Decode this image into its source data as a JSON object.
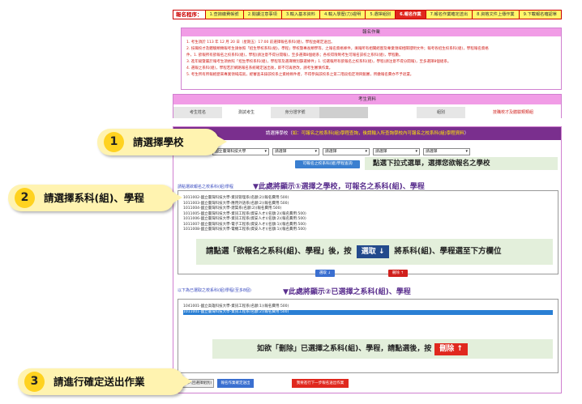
{
  "steps": {
    "lead": "報名程序：",
    "items": [
      "1.查詢繳費帳號",
      "2.閱讀注意事項",
      "3.輸入基本資料",
      "4.輸入學歷(力)證明",
      "5.選擇組別",
      "6.報名作業",
      "7.報名作業確定送出",
      "8.資格文件上傳作業",
      "9.下載報名確認單"
    ],
    "active_index": 5
  },
  "notice": {
    "title": "報名作業",
    "items": [
      "1. 考生須於 113 年 12 月 20 日（星期五）17:00 前選擇報名系科(組)，學程並確定送出。",
      "2. 技職校才及體驗類類報考生請依照「招生學校系科(組)，學程」學校暨專長類學等，之報名資格條件，填報所有相關經歷及專業領域相關證明文件；報考各招生校系科(組)，學程報名資格",
      "   件，1. 欲報所有欲報名之校系科(組)，學程(請注意不得分開報)，至多選擇8個組系；各校得限制考生可報名該校之系科(組)，學程數。",
      "3. 進年級暨屬於報考生須依照「招生學校系科(組)，學程等及選擇類別篩選條件」1. 切選報所有欲報名之校系科(組)，學程(請注意不得分開報)，至多選擇8個組系。",
      "4. 選報之系科(組)，學程若於網路報名系統確定送出後，即不可再更改，請考生審慎作業。",
      "5. 考生所有所報經歷來專業領域成就，經審查未錄該校系之資格條件者，不得參與該校系之第二階段指定項目甄審，所繳報名費亦不予退還。"
    ]
  },
  "applicant": {
    "title": "考生資料",
    "name_label": "考生姓名",
    "name_value": "測試考生",
    "id_label": "身分證字號",
    "id_value": "",
    "category_label": "組別",
    "category_value": "技職校才及體驗類類組"
  },
  "selection": {
    "header_prefix": "請選擇學校（",
    "header_highlight": "如：可報名之校系科(組)學程查詢，後請輸入所查詢學校內可報名之校系科(組)學程資料",
    "header_suffix": "）",
    "selects": [
      "國立臺灣科技大學",
      "請選擇",
      "請選擇",
      "請選擇",
      "請選擇"
    ],
    "query_button": "可報名之校系科(組)學程查詢",
    "hint_select": "點選下拉式選單，選擇您欲報名之學校",
    "available_label": "請點選欲報名之校系科(組)學程",
    "available_annotation": "▼此處將顯示①選擇之學校，可報名之系科(組)、學程",
    "available_options": [
      "1011002-國立臺灣科技大學-資訊管理系(名額:2)(報名費用:500)",
      "1011003-國立臺灣科技大學-應用外語系(名額:2)(報名費用:500)",
      "1011004-國立臺灣科技大學-建築系(名額:2)(報名費用:500)",
      "1011005-國立臺灣科技大學-資訊工程系(資安人才)(名額:2)(報名費用:500)",
      "1011006-國立臺灣科技大學-資訊工程系(資安人才)(名額:2)(報名費用:500)",
      "1011007-國立臺灣科技大學-電子工程系(資安人才)(名額:1)(報名費用:500)",
      "1011008-國立臺灣科技大學-電機工程系(資安人才)(名額:1)(報名費用:500)"
    ],
    "hint_move_prefix": "請點選「欲報名之系科(組)、學程」後，按",
    "hint_move_chip": "選取 ↓",
    "hint_move_suffix": "將系科(組)、學程選至下方欄位",
    "select_button": "選取 ↓",
    "remove_button": "刪除 ↑",
    "chosen_label": "以下為已選取之校系科(組)學程(至多8個)",
    "chosen_annotation": "▼此處將顯示②已選擇之系科(組)、學程",
    "chosen_options": [
      "1041001-國立高雄科技大學-資訊工程系(名額:1)(報名費用:500)",
      "1011001-國立臺灣科技大學-資訊工程系(名額:2)(報名費用:500)"
    ],
    "chosen_active_index": 1,
    "hint_remove_prefix": "如欲「刪除」已選擇之系科(組)、學程，請點選後，按",
    "hint_remove_chip": "刪除 ↑",
    "prev_button": "上一步(回選擇組別)",
    "confirm_button": "報名作業確定送出",
    "next_button": "我要進行下一步報名送出作業"
  },
  "callouts": [
    {
      "num": "1",
      "text": "請選擇學校"
    },
    {
      "num": "2",
      "text": "請選擇系科(組)、學程"
    },
    {
      "num": "3",
      "text": "請進行確定送出作業"
    }
  ]
}
